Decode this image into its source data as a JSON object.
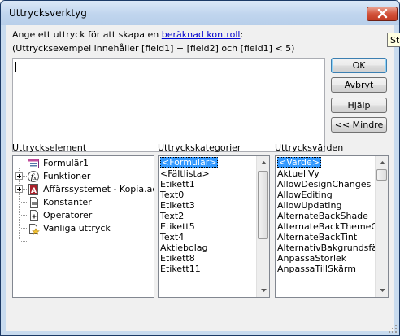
{
  "window": {
    "title": "Uttrycksverktyg"
  },
  "tooltip": {
    "text": "Stäng"
  },
  "instructions": {
    "line1_prefix": "Ange ett uttryck för att skapa en ",
    "line1_link": "beräknad kontroll",
    "line1_suffix": ":",
    "line2": "(Uttrycksexempel innehåller [field1] + [field2] och [field1] < 5)"
  },
  "expression": {
    "value": ""
  },
  "buttons": {
    "ok": "OK",
    "cancel": "Avbryt",
    "help": "Hjälp",
    "less": "<< Mindre"
  },
  "sections": {
    "elements_label": "Uttryckselement",
    "categories_label": "Uttryckskategorier",
    "values_label": "Uttrycksvärden"
  },
  "tree": [
    {
      "label": "Formulär1",
      "expandable": false,
      "icon": "form-icon"
    },
    {
      "label": "Funktioner",
      "expandable": true,
      "icon": "function-icon"
    },
    {
      "label": "Affärssystemet - Kopia.accdb",
      "expandable": true,
      "icon": "database-icon"
    },
    {
      "label": "Konstanter",
      "expandable": false,
      "icon": "constants-icon"
    },
    {
      "label": "Operatorer",
      "expandable": false,
      "icon": "operators-icon"
    },
    {
      "label": "Vanliga uttryck",
      "expandable": false,
      "icon": "common-expressions-icon"
    }
  ],
  "categories": [
    "<Formulär>",
    "<Fältlista>",
    "Etikett1",
    "Text0",
    "Etikett3",
    "Text2",
    "Etikett5",
    "Text4",
    "Aktiebolag",
    "Etikett8",
    "Etikett11"
  ],
  "values": [
    "<Värde>",
    "AktuellVy",
    "AllowDesignChanges",
    "AllowEditing",
    "AllowUpdating",
    "AlternateBackShade",
    "AlternateBackThemeColorIndex",
    "AlternateBackTint",
    "AlternativBakgrundsfärg",
    "AnpassaStorlek",
    "AnpassaTillSkärm"
  ],
  "colors": {
    "selection": "#3399ff",
    "link": "#0000cc",
    "titlebar": "#c0d5ee"
  }
}
